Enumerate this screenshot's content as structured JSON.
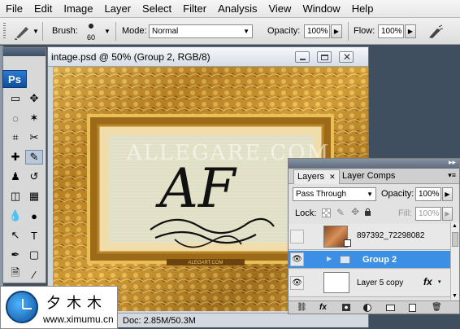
{
  "menu": [
    "File",
    "Edit",
    "Image",
    "Layer",
    "Select",
    "Filter",
    "Analysis",
    "View",
    "Window",
    "Help"
  ],
  "options": {
    "brush_label": "Brush:",
    "brush_size": "60",
    "mode_label": "Mode:",
    "mode_value": "Normal",
    "opacity_label": "Opacity:",
    "opacity_value": "100%",
    "flow_label": "Flow:",
    "flow_value": "100%"
  },
  "toolbox": {
    "logo": "Ps"
  },
  "document": {
    "title": "intage.psd @ 50% (Group 2, RGB/8)",
    "status": "Doc: 2.85M/50.3M",
    "watermark_text": "ALLEGARE.COM",
    "monogram": "AF",
    "plaque": "ALEGART.COM"
  },
  "logo_watermark": {
    "cn": "夕木木",
    "url": "www.ximumu.cn"
  },
  "layers_panel": {
    "tabs": [
      "Layers",
      "Layer Comps"
    ],
    "blend_mode": "Pass Through",
    "opacity_label": "Opacity:",
    "opacity_value": "100%",
    "lock_label": "Lock:",
    "fill_label": "Fill:",
    "fill_value": "100%",
    "layers": [
      {
        "name": "897392_72298082",
        "visible": false,
        "selected": false
      },
      {
        "name": "Group 2",
        "visible": true,
        "selected": true
      },
      {
        "name": "Layer 5 copy",
        "visible": true,
        "selected": false
      }
    ],
    "footer_icons": [
      "link-icon",
      "fx-icon",
      "mask-icon",
      "adjustment-icon",
      "folder-icon",
      "new-layer-icon",
      "trash-icon"
    ]
  },
  "colors": {
    "accent_selected": "#3b8fe4",
    "frame_gold": "#c9952a"
  }
}
